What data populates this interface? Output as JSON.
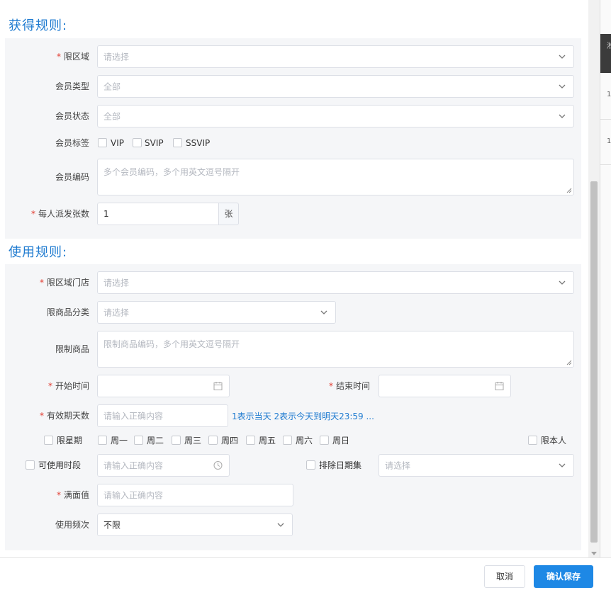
{
  "acquire": {
    "title": "获得规则:",
    "region": {
      "label": "限区域",
      "placeholder": "请选择"
    },
    "member_type": {
      "label": "会员类型",
      "value": "全部"
    },
    "member_status": {
      "label": "会员状态",
      "value": "全部"
    },
    "member_tags": {
      "label": "会员标签",
      "options": [
        "VIP",
        "SVIP",
        "SSVIP"
      ]
    },
    "member_codes": {
      "label": "会员编码",
      "placeholder": "多个会员编码，多个用英文逗号隔开"
    },
    "per_person": {
      "label": "每人派发张数",
      "value": "1",
      "unit": "张"
    }
  },
  "usage": {
    "title": "使用规则:",
    "store": {
      "label": "限区域门店",
      "placeholder": "请选择"
    },
    "category": {
      "label": "限商品分类",
      "placeholder": "请选择"
    },
    "products": {
      "label": "限制商品",
      "placeholder": "限制商品编码，多个用英文逗号隔开"
    },
    "start_time": {
      "label": "开始时间"
    },
    "end_time": {
      "label": "结束时间"
    },
    "valid_days": {
      "label": "有效期天数",
      "placeholder": "请输入正确内容",
      "hint": "1表示当天 2表示今天到明天23:59 ..."
    },
    "weekday": {
      "label": "限星期",
      "days": [
        "周一",
        "周二",
        "周三",
        "周四",
        "周五",
        "周六",
        "周日"
      ]
    },
    "self_only": {
      "label": "限本人"
    },
    "time_slot": {
      "label": "可使用时段",
      "placeholder": "请输入正确内容"
    },
    "exclude_dates": {
      "label": "排除日期集",
      "placeholder": "请选择"
    },
    "threshold": {
      "label": "满面值",
      "placeholder": "请输入正确内容"
    },
    "frequency": {
      "label": "使用频次",
      "value": "不限"
    }
  },
  "footer": {
    "cancel": "取消",
    "confirm": "确认保存"
  },
  "background": {
    "row1": "1",
    "row2": "1",
    "header_char": "淞"
  },
  "colors": {
    "accent": "#1e88e5",
    "title": "#1f7bd0",
    "required": "#e23a2e"
  }
}
